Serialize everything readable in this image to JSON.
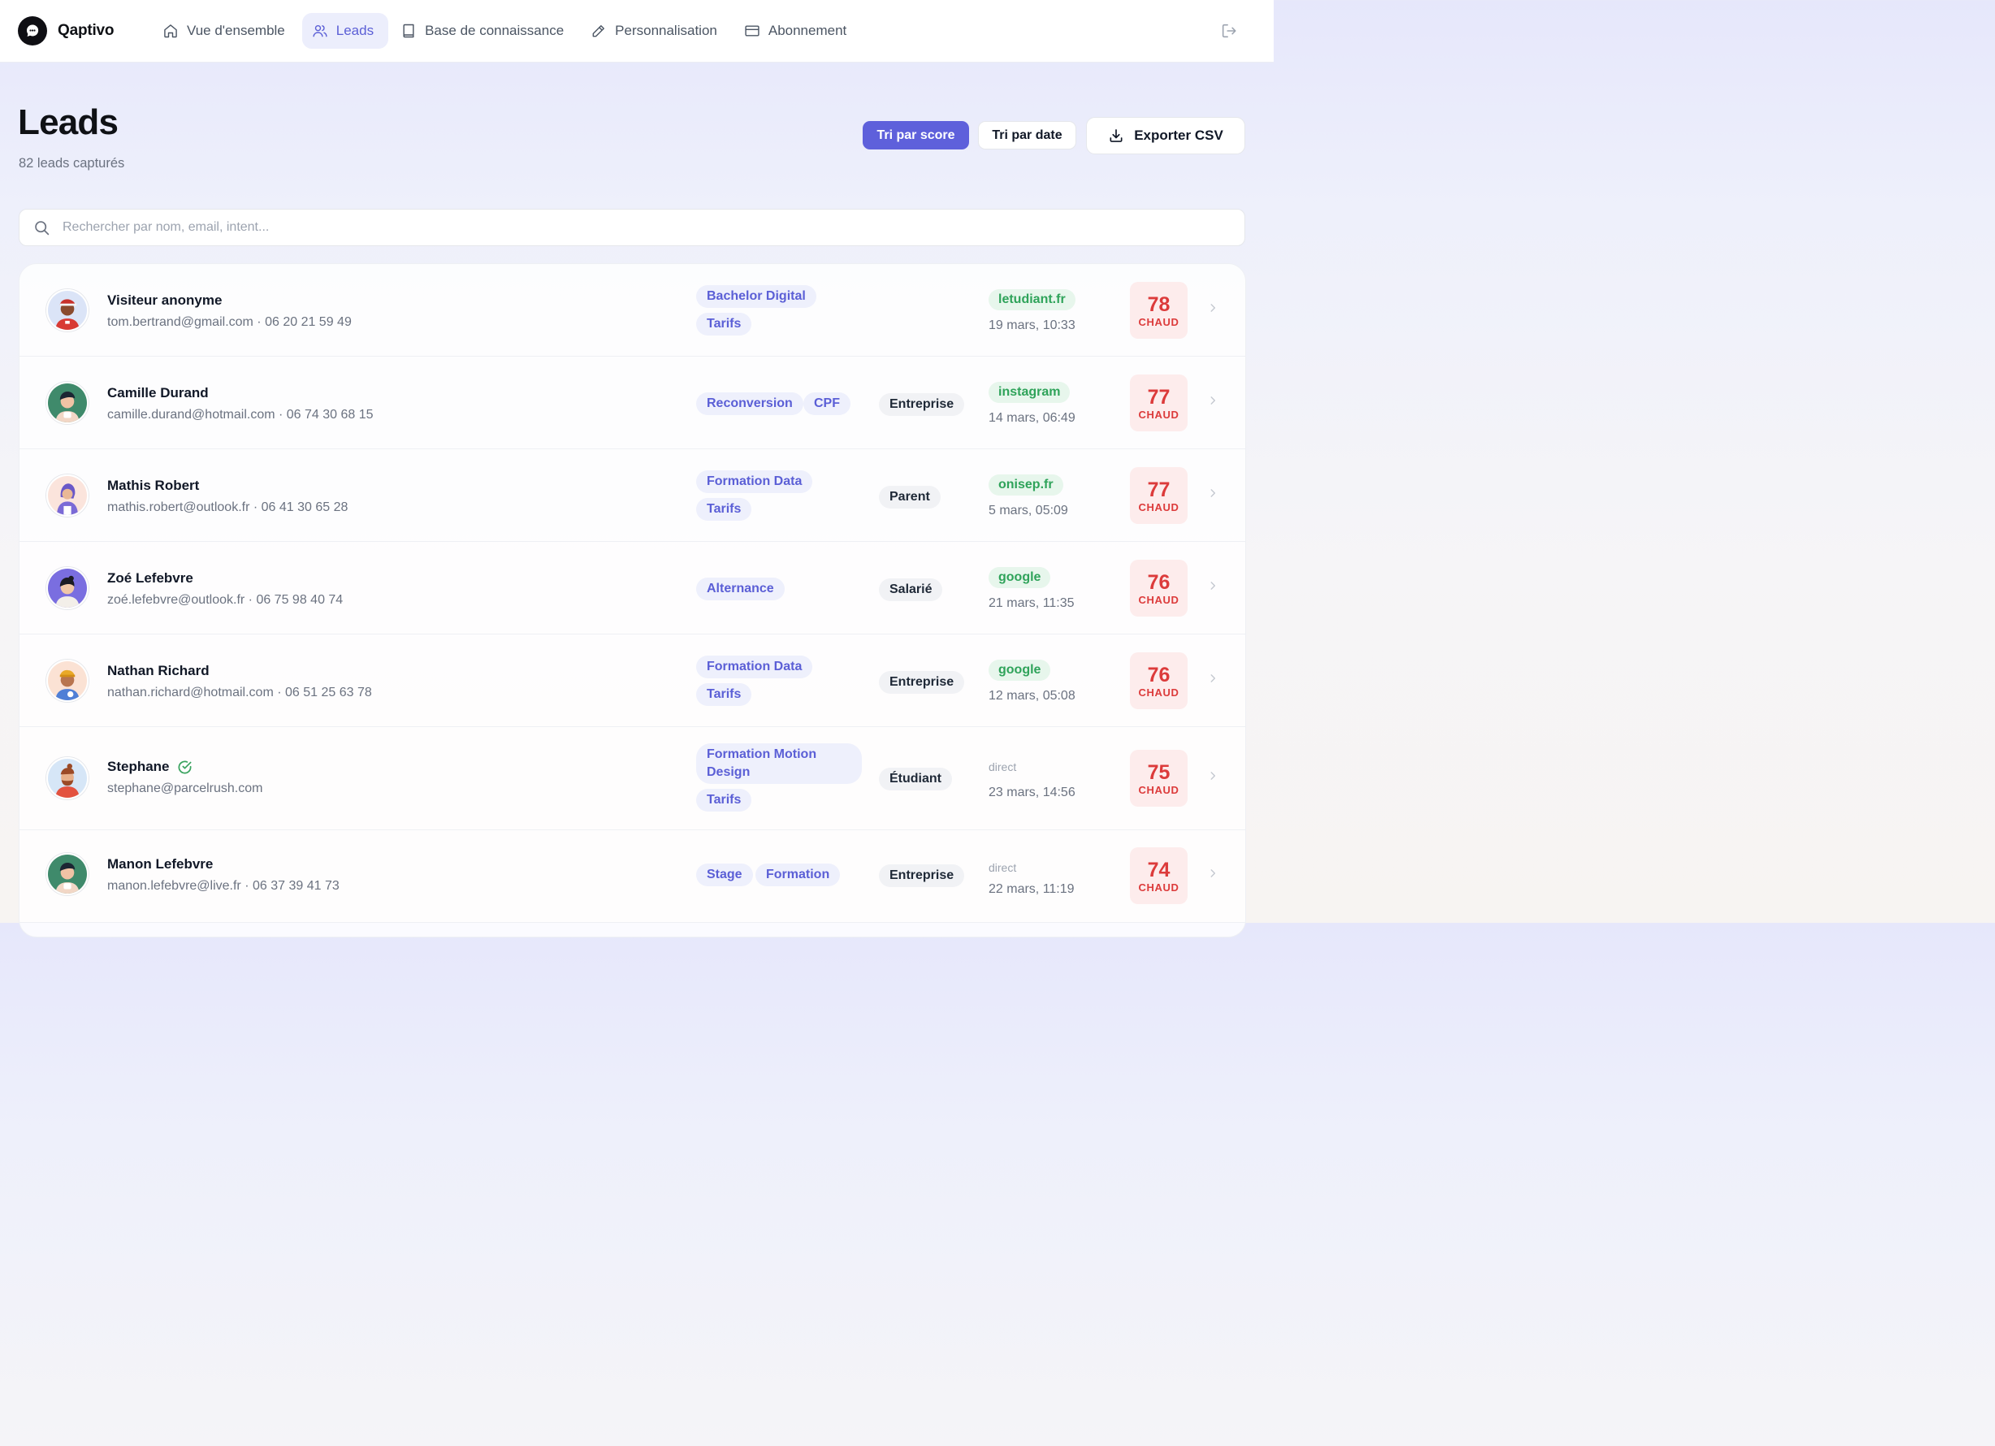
{
  "brand": {
    "name": "Qaptivo"
  },
  "nav": [
    {
      "label": "Vue d'ensemble",
      "icon": "home-icon",
      "active": false
    },
    {
      "label": "Leads",
      "icon": "users-icon",
      "active": true
    },
    {
      "label": "Base de connaissance",
      "icon": "book-icon",
      "active": false
    },
    {
      "label": "Personnalisation",
      "icon": "pencil-icon",
      "active": false
    },
    {
      "label": "Abonnement",
      "icon": "credit-card-icon",
      "active": false
    }
  ],
  "page": {
    "title": "Leads",
    "subtitle": "82 leads capturés"
  },
  "actions": {
    "sort_score": "Tri par score",
    "sort_date": "Tri par date",
    "export": "Exporter CSV",
    "active_sort": "score"
  },
  "search": {
    "placeholder": "Rechercher par nom, email, intent...",
    "value": ""
  },
  "colors": {
    "accent": "#5e60db",
    "hot": "#dc3b3b",
    "source": "#2fa35a"
  },
  "leads": [
    {
      "name": "Visiteur anonyme",
      "verified": false,
      "email": "tom.bertrand@gmail.com",
      "phone": "06 20 21 59 49",
      "contact": "tom.bertrand@gmail.com · 06 20 21 59 49",
      "tags": [
        "Bachelor Digital",
        "Tarifs"
      ],
      "profile": "",
      "source": "letudiant.fr",
      "date": "19 mars, 10:33",
      "score": "78",
      "heat": "CHAUD"
    },
    {
      "name": "Camille Durand",
      "verified": false,
      "email": "camille.durand@hotmail.com",
      "phone": "06 74 30 68 15",
      "contact": "camille.durand@hotmail.com · 06 74 30 68 15",
      "tags": [
        "Reconversion",
        "CPF"
      ],
      "profile": "Entreprise",
      "source": "instagram",
      "date": "14 mars, 06:49",
      "score": "77",
      "heat": "CHAUD"
    },
    {
      "name": "Mathis Robert",
      "verified": false,
      "email": "mathis.robert@outlook.fr",
      "phone": "06 41 30 65 28",
      "contact": "mathis.robert@outlook.fr · 06 41 30 65 28",
      "tags": [
        "Formation Data",
        "Tarifs"
      ],
      "profile": "Parent",
      "source": "onisep.fr",
      "date": "5 mars, 05:09",
      "score": "77",
      "heat": "CHAUD"
    },
    {
      "name": "Zoé Lefebvre",
      "verified": false,
      "email": "zoé.lefebvre@outlook.fr",
      "phone": "06 75 98 40 74",
      "contact": "zoé.lefebvre@outlook.fr · 06 75 98 40 74",
      "tags": [
        "Alternance"
      ],
      "profile": "Salarié",
      "source": "google",
      "date": "21 mars, 11:35",
      "score": "76",
      "heat": "CHAUD"
    },
    {
      "name": "Nathan Richard",
      "verified": false,
      "email": "nathan.richard@hotmail.com",
      "phone": "06 51 25 63 78",
      "contact": "nathan.richard@hotmail.com · 06 51 25 63 78",
      "tags": [
        "Formation Data",
        "Tarifs"
      ],
      "profile": "Entreprise",
      "source": "google",
      "date": "12 mars, 05:08",
      "score": "76",
      "heat": "CHAUD"
    },
    {
      "name": "Stephane",
      "verified": true,
      "email": "stephane@parcelrush.com",
      "phone": "",
      "contact": "stephane@parcelrush.com",
      "tags": [
        "Formation Motion Design",
        "Tarifs"
      ],
      "profile": "Étudiant",
      "source": "direct",
      "date": "23 mars, 14:56",
      "score": "75",
      "heat": "CHAUD"
    },
    {
      "name": "Manon Lefebvre",
      "verified": false,
      "email": "manon.lefebvre@live.fr",
      "phone": "06 37 39 41 73",
      "contact": "manon.lefebvre@live.fr · 06 37 39 41 73",
      "tags": [
        "Stage",
        "Formation"
      ],
      "profile": "Entreprise",
      "source": "direct",
      "date": "22 mars, 11:19",
      "score": "74",
      "heat": "CHAUD"
    }
  ]
}
